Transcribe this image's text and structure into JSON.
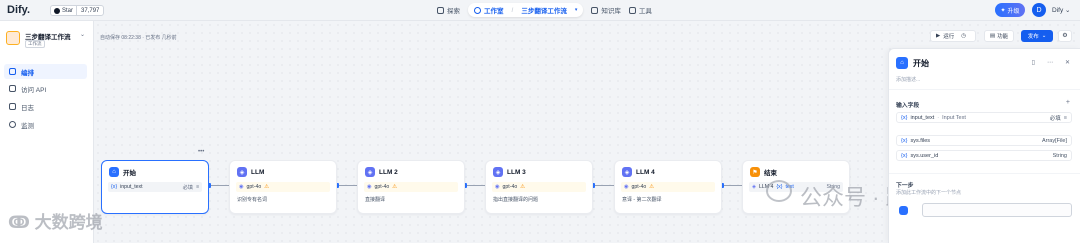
{
  "header": {
    "logo": "Dify.",
    "github": {
      "label": "Star",
      "count": "37,797"
    },
    "nav": {
      "explore": "探索",
      "studio": "工作室",
      "current_app": "三步翻译工作流",
      "knowledge": "知识库",
      "tools": "工具"
    },
    "upgrade": "升级",
    "user": {
      "initial": "D",
      "name": "Dify"
    }
  },
  "sidebar": {
    "app_name": "三步翻译工作流",
    "app_type": "工作流",
    "items": [
      {
        "label": "编排",
        "icon": "layout-icon",
        "active": true
      },
      {
        "label": "访问 API",
        "icon": "terminal-icon",
        "active": false
      },
      {
        "label": "日志",
        "icon": "document-icon",
        "active": false
      },
      {
        "label": "监测",
        "icon": "monitor-icon",
        "active": false
      }
    ]
  },
  "canvas": {
    "autosave": "自动保存 08:22:38 · 已发布 几秒前",
    "toolbar": {
      "run": "运行",
      "features": "功能",
      "publish": "发布"
    },
    "nodes": [
      {
        "title": "开始",
        "type": "start",
        "row": "input_text",
        "row_tag": "必填",
        "desc": ""
      },
      {
        "title": "LLM",
        "type": "llm",
        "row": "gpt-4o",
        "desc": "识别专有名词"
      },
      {
        "title": "LLM 2",
        "type": "llm",
        "row": "gpt-4o",
        "desc": "直接翻译"
      },
      {
        "title": "LLM 3",
        "type": "llm",
        "row": "gpt-4o",
        "desc": "指出直接翻译的问题"
      },
      {
        "title": "LLM 4",
        "type": "llm",
        "row": "gpt-4o",
        "desc": "意译 - 第二次翻译"
      },
      {
        "title": "结束",
        "type": "end",
        "row": "LLM 4",
        "row_var": "text",
        "row_tag": "String",
        "desc": ""
      }
    ]
  },
  "panel": {
    "title": "开始",
    "description": "添加描述...",
    "input_section": "输入字段",
    "input_var": {
      "name": "input_text",
      "label": "Input Text",
      "tag": "必填"
    },
    "sys_vars": [
      {
        "name": "sys.files",
        "type": "Array[File]"
      },
      {
        "name": "sys.user_id",
        "type": "String"
      }
    ],
    "next_label": "下一步",
    "next_desc": "添加此工作流中的下一个节点"
  },
  "watermark": {
    "left": "大数跨境",
    "right": "公众号 · 路上侠客"
  },
  "colors": {
    "primary": "#155eef",
    "warning": "#f79009",
    "canvas_bg": "#f2f4f7"
  }
}
